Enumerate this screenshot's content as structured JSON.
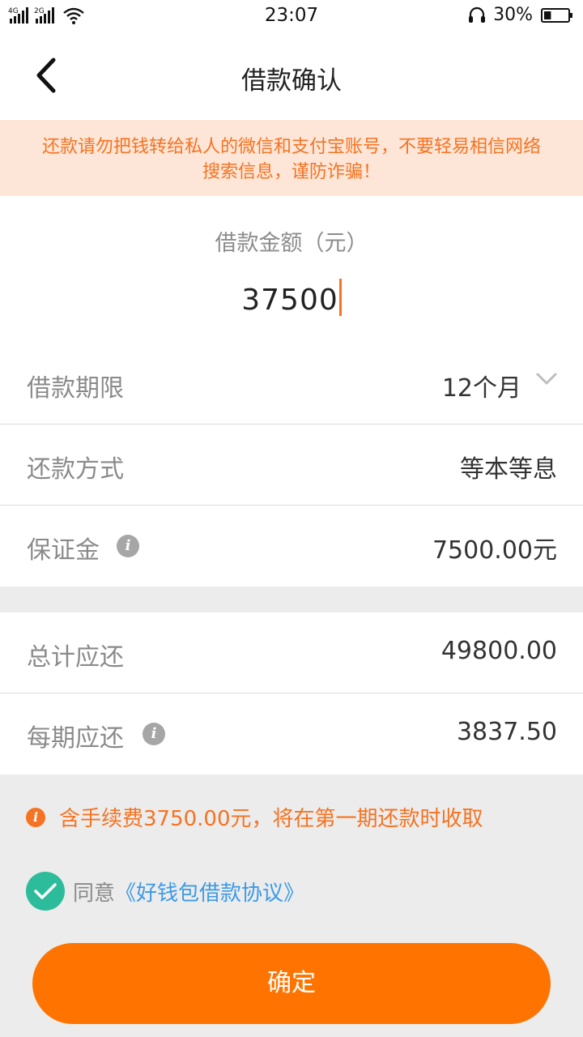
{
  "status_bar": {
    "network_1": "4G",
    "network_2": "2G",
    "time": "23:07",
    "battery_percent": "30%",
    "battery_level": 0.3,
    "icons": [
      "signal-icon",
      "wifi-icon",
      "headset-icon",
      "battery-icon"
    ]
  },
  "header": {
    "title": "借款确认",
    "back_icon": "back-arrow-icon"
  },
  "warning": {
    "line1": "还款请勿把钱转给私人的微信和支付宝账号，不要轻易相信网络",
    "line2": "搜索信息，谨防诈骗！"
  },
  "loan_amount": {
    "label": "借款金额（元）",
    "value": "37500"
  },
  "details": {
    "term": {
      "label": "借款期限",
      "value": "12个月"
    },
    "repayment_method": {
      "label": "还款方式",
      "value": "等本等息"
    },
    "deposit": {
      "label": "保证金",
      "value": "7500.00元"
    }
  },
  "summary": {
    "total_repay": {
      "label": "总计应还",
      "value": "49800.00"
    },
    "per_period": {
      "label": "每期应还",
      "value": "3837.50"
    }
  },
  "fee_note": {
    "text": "含手续费3750.00元，将在第一期还款时收取"
  },
  "agreement": {
    "checked": true,
    "prefix": "同意",
    "link": "《好钱包借款协议》"
  },
  "confirm_button": {
    "label": "确定"
  },
  "colors": {
    "accent": "#ff7400",
    "warning_bg": "#fde6d7",
    "warning_text": "#f57322",
    "check": "#2dbc9b",
    "link": "#3c9ae6"
  }
}
